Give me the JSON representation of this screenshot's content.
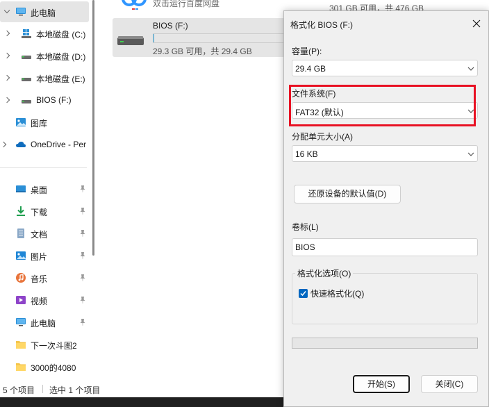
{
  "nav": {
    "items": [
      {
        "label": "此电脑",
        "icon": "computer-icon",
        "chevron": "down",
        "selected": true
      },
      {
        "label": "本地磁盘 (C:)",
        "icon": "windows-drive-icon",
        "chevron": "right"
      },
      {
        "label": "本地磁盘 (D:)",
        "icon": "drive-icon",
        "chevron": "right"
      },
      {
        "label": "本地磁盘 (E:)",
        "icon": "drive-icon",
        "chevron": "right"
      },
      {
        "label": "BIOS (F:)",
        "icon": "drive-icon",
        "chevron": "right"
      },
      {
        "label": "图库",
        "icon": "gallery-icon"
      },
      {
        "label": "OneDrive - Per",
        "icon": "onedrive-icon",
        "chevron": "right"
      }
    ],
    "quick_access": [
      {
        "label": "桌面",
        "icon": "desktop-icon",
        "pinned": true
      },
      {
        "label": "下载",
        "icon": "download-icon",
        "pinned": true
      },
      {
        "label": "文档",
        "icon": "document-icon",
        "pinned": true
      },
      {
        "label": "图片",
        "icon": "pictures-icon",
        "pinned": true
      },
      {
        "label": "音乐",
        "icon": "music-icon",
        "pinned": true
      },
      {
        "label": "视频",
        "icon": "video-icon",
        "pinned": true
      },
      {
        "label": "此电脑",
        "icon": "computer-icon",
        "pinned": true
      },
      {
        "label": "下一次斗图2",
        "icon": "folder-icon"
      },
      {
        "label": "3000的4080",
        "icon": "folder-icon"
      }
    ]
  },
  "content": {
    "partial_item_name": "双击运行百度网盘",
    "partial_item_space": "301 GB 可用，共 476 GB",
    "bios_tile": {
      "name": "BIOS (F:)",
      "space": "29.3 GB 可用，共 29.4 GB",
      "used_fraction": 0.003
    }
  },
  "status": {
    "item_count": "5 个项目",
    "selected": "选中 1 个项目"
  },
  "dialog": {
    "title": "格式化 BIOS (F:)",
    "capacity_label": "容量(P):",
    "capacity_value": "29.4 GB",
    "filesystem_label": "文件系统(F)",
    "filesystem_value": "FAT32 (默认)",
    "allocation_label": "分配单元大小(A)",
    "allocation_value": "16 KB",
    "restore_defaults": "还原设备的默认值(D)",
    "volume_label_label": "卷标(L)",
    "volume_label_value": "BIOS",
    "options_title": "格式化选项(O)",
    "quick_format_label": "快速格式化(Q)",
    "quick_format_checked": true,
    "progress_fraction": 0,
    "start_button": "开始(S)",
    "close_button": "关闭(C)",
    "highlight_color": "#e81123"
  }
}
